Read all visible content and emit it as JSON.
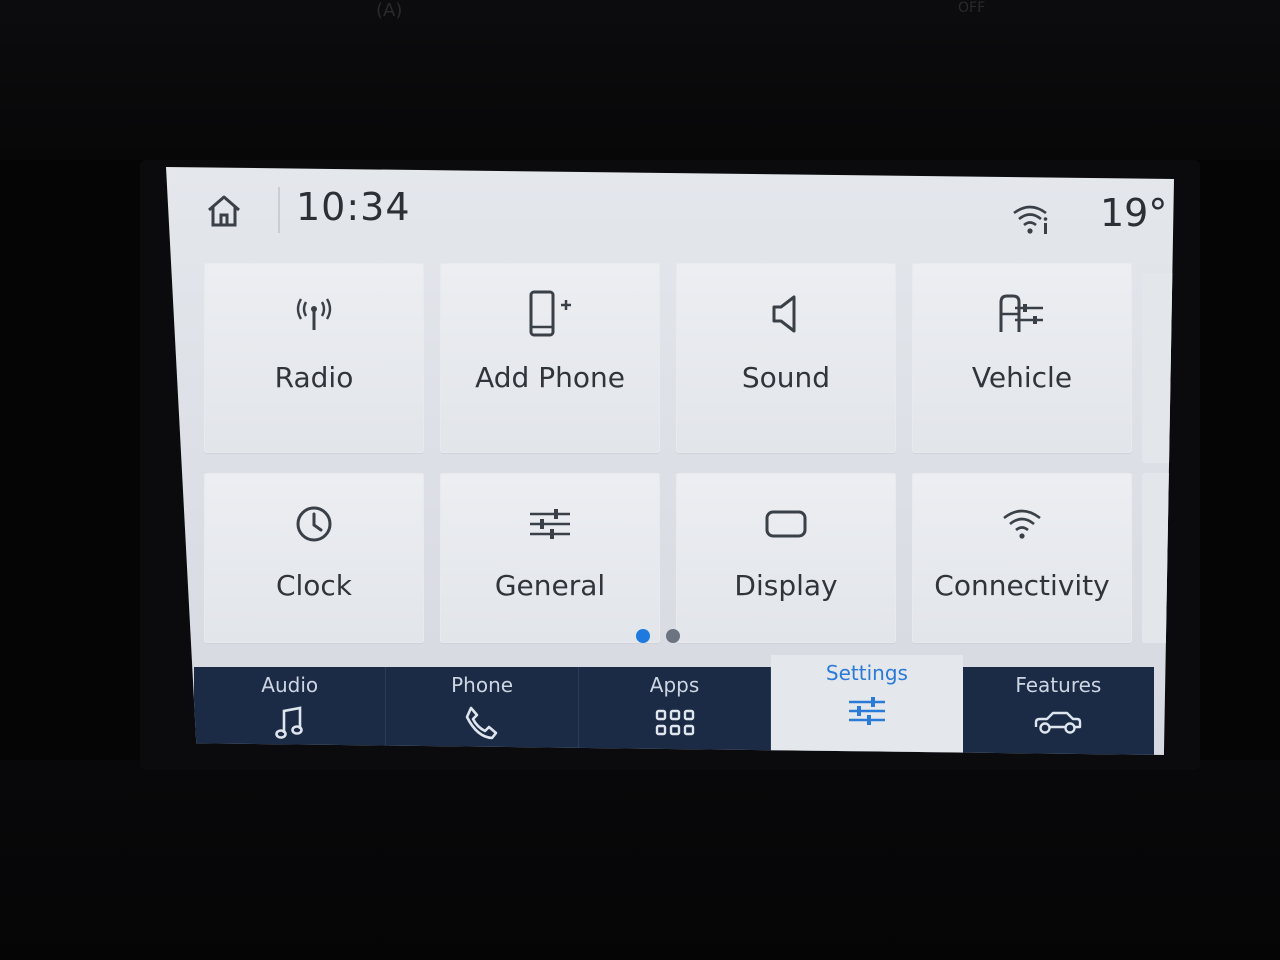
{
  "bezel": {
    "labels": [
      "(A)",
      "OFF"
    ]
  },
  "status_bar": {
    "time": "10:34",
    "temperature": "19°",
    "home_icon": "home-icon",
    "wifi_icon": "wifi-info-icon"
  },
  "settings_grid": {
    "tiles": [
      {
        "label": "Radio",
        "icon": "radio-antenna-icon"
      },
      {
        "label": "Add Phone",
        "icon": "add-phone-icon"
      },
      {
        "label": "Sound",
        "icon": "speaker-icon"
      },
      {
        "label": "Vehicle",
        "icon": "vehicle-settings-icon"
      },
      {
        "label": "Clock",
        "icon": "clock-icon"
      },
      {
        "label": "General",
        "icon": "sliders-icon"
      },
      {
        "label": "Display",
        "icon": "display-icon"
      },
      {
        "label": "Connectivity",
        "icon": "wifi-icon"
      }
    ]
  },
  "pagination": {
    "pages": 2,
    "current": 1,
    "active_color": "#1f7ae0",
    "inactive_color": "#6b7480"
  },
  "nav": {
    "items": [
      {
        "label": "Audio",
        "icon": "music-note-icon"
      },
      {
        "label": "Phone",
        "icon": "phone-handset-icon"
      },
      {
        "label": "Apps",
        "icon": "apps-grid-icon"
      },
      {
        "label": "Settings",
        "icon": "settings-sliders-icon",
        "active": true
      },
      {
        "label": "Features",
        "icon": "car-icon"
      }
    ]
  },
  "colors": {
    "nav_background": "#1c2b45",
    "active_label": "#2a7ad8",
    "active_indicator": "#3fb7d1",
    "tile_background": "#e6e9ee"
  }
}
